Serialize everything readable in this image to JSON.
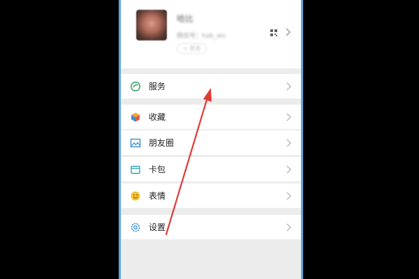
{
  "profile": {
    "nickname": "哈比",
    "wxid": "微信号：hab_wx",
    "status": "+ 状态"
  },
  "menu": {
    "services": {
      "label": "服务",
      "icon": "services-icon"
    },
    "favorites": {
      "label": "收藏",
      "icon": "favorites-cube-icon"
    },
    "moments": {
      "label": "朋友圈",
      "icon": "moments-picture-icon"
    },
    "cards": {
      "label": "卡包",
      "icon": "card-wallet-icon"
    },
    "stickers": {
      "label": "表情",
      "icon": "sticker-smiley-icon"
    },
    "settings": {
      "label": "设置",
      "icon": "settings-gear-icon"
    }
  },
  "colors": {
    "accent_blue": "#5aa7de",
    "arrow_red": "#e03a35",
    "services_green": "#3aa66a",
    "stickers_yellow": "#f2c233"
  }
}
